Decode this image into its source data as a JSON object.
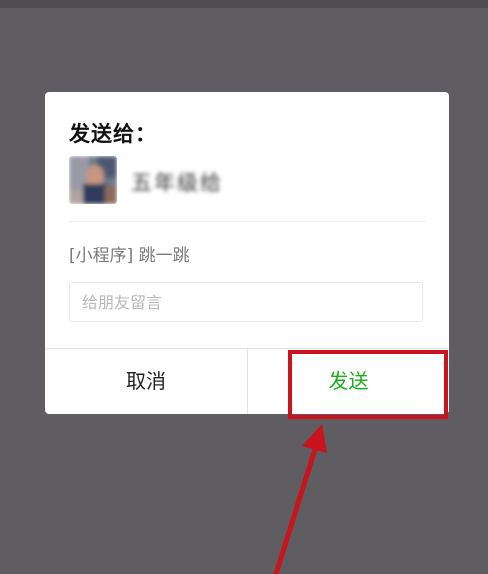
{
  "dialog": {
    "title": "发送给：",
    "recipient_name": "五年级给",
    "share_title": "[小程序] 跳一跳",
    "message_placeholder": "给朋友留言",
    "cancel_label": "取消",
    "send_label": "发送"
  },
  "colors": {
    "overlay": "#5f5d61",
    "send_text": "#1aad19",
    "annotation": "#c8141a"
  },
  "icons": {
    "avatar": "avatar-image",
    "annotation_arrow": "red-arrow-icon"
  }
}
